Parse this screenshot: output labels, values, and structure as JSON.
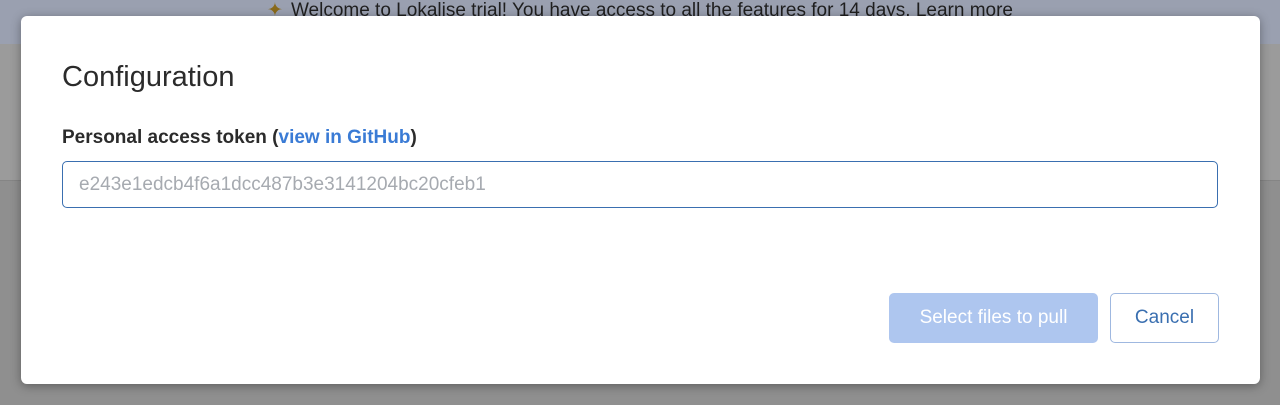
{
  "banner": {
    "icon": "party-popper-icon",
    "text": "Welcome to Lokalise trial! You have access to all the features for 14 days. Learn more"
  },
  "modal": {
    "title": "Configuration",
    "field": {
      "label_prefix": "Personal access token (",
      "link_text": "view in GitHub",
      "label_suffix": ")",
      "placeholder": "e243e1edcb4f6a1dcc487b3e3141204bc20cfeb1",
      "value": ""
    },
    "buttons": {
      "primary_label": "Select files to pull",
      "primary_disabled": true,
      "cancel_label": "Cancel"
    }
  },
  "colors": {
    "accent": "#3a7bd5",
    "primary_disabled_bg": "#aec6ef",
    "overlay": "#8f8f8f"
  }
}
